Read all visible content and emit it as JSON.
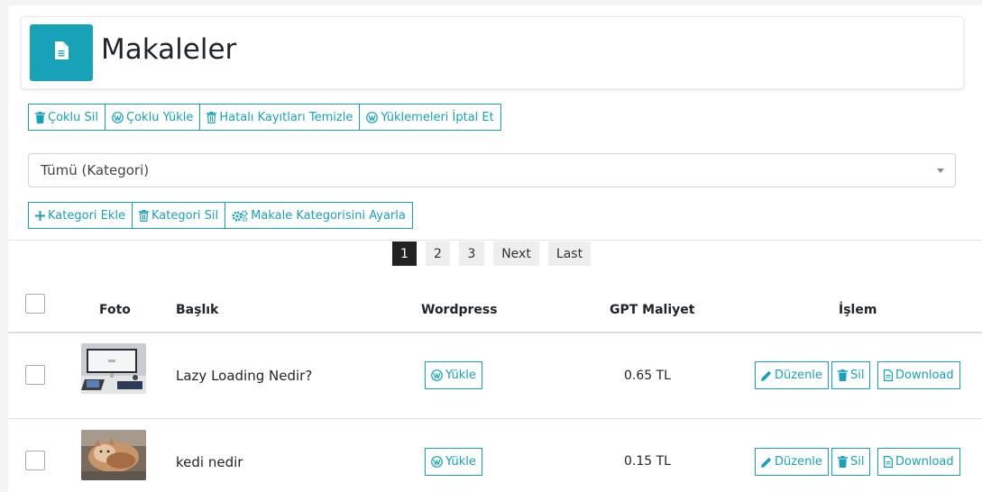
{
  "header": {
    "title": "Makaleler",
    "icon": "document-icon"
  },
  "bulk_actions": [
    {
      "label": "Çoklu Sil",
      "icon": "trash-icon"
    },
    {
      "label": "Çoklu Yükle",
      "icon": "wordpress-icon"
    },
    {
      "label": "Hatalı Kayıtları Temizle",
      "icon": "trash-outline-icon"
    },
    {
      "label": "Yüklemeleri İptal Et",
      "icon": "wordpress-icon"
    }
  ],
  "category_select": {
    "selected": "Tümü (Kategori)"
  },
  "category_actions": [
    {
      "label": "Kategori Ekle",
      "icon": "plus-icon"
    },
    {
      "label": "Kategori Sil",
      "icon": "trash-outline-icon"
    },
    {
      "label": "Makale Kategorisini Ayarla",
      "icon": "gears-icon"
    }
  ],
  "pagination": {
    "pages": [
      "1",
      "2",
      "3"
    ],
    "active": "1",
    "next": "Next",
    "last": "Last"
  },
  "table": {
    "columns": {
      "photo": "Foto",
      "title": "Başlık",
      "wordpress": "Wordpress",
      "cost": "GPT Maliyet",
      "action": "İşlem"
    },
    "rows": [
      {
        "title": "Lazy Loading Nedir?",
        "wordpress_label": "Yükle",
        "cost": "0.65 TL",
        "edit_label": "Düzenle",
        "delete_label": "Sil",
        "download_label": "Download"
      },
      {
        "title": "kedi nedir",
        "wordpress_label": "Yükle",
        "cost": "0.15 TL",
        "edit_label": "Düzenle",
        "delete_label": "Sil",
        "download_label": "Download"
      }
    ]
  },
  "colors": {
    "accent": "#17a2b8",
    "active_page": "#222222"
  }
}
